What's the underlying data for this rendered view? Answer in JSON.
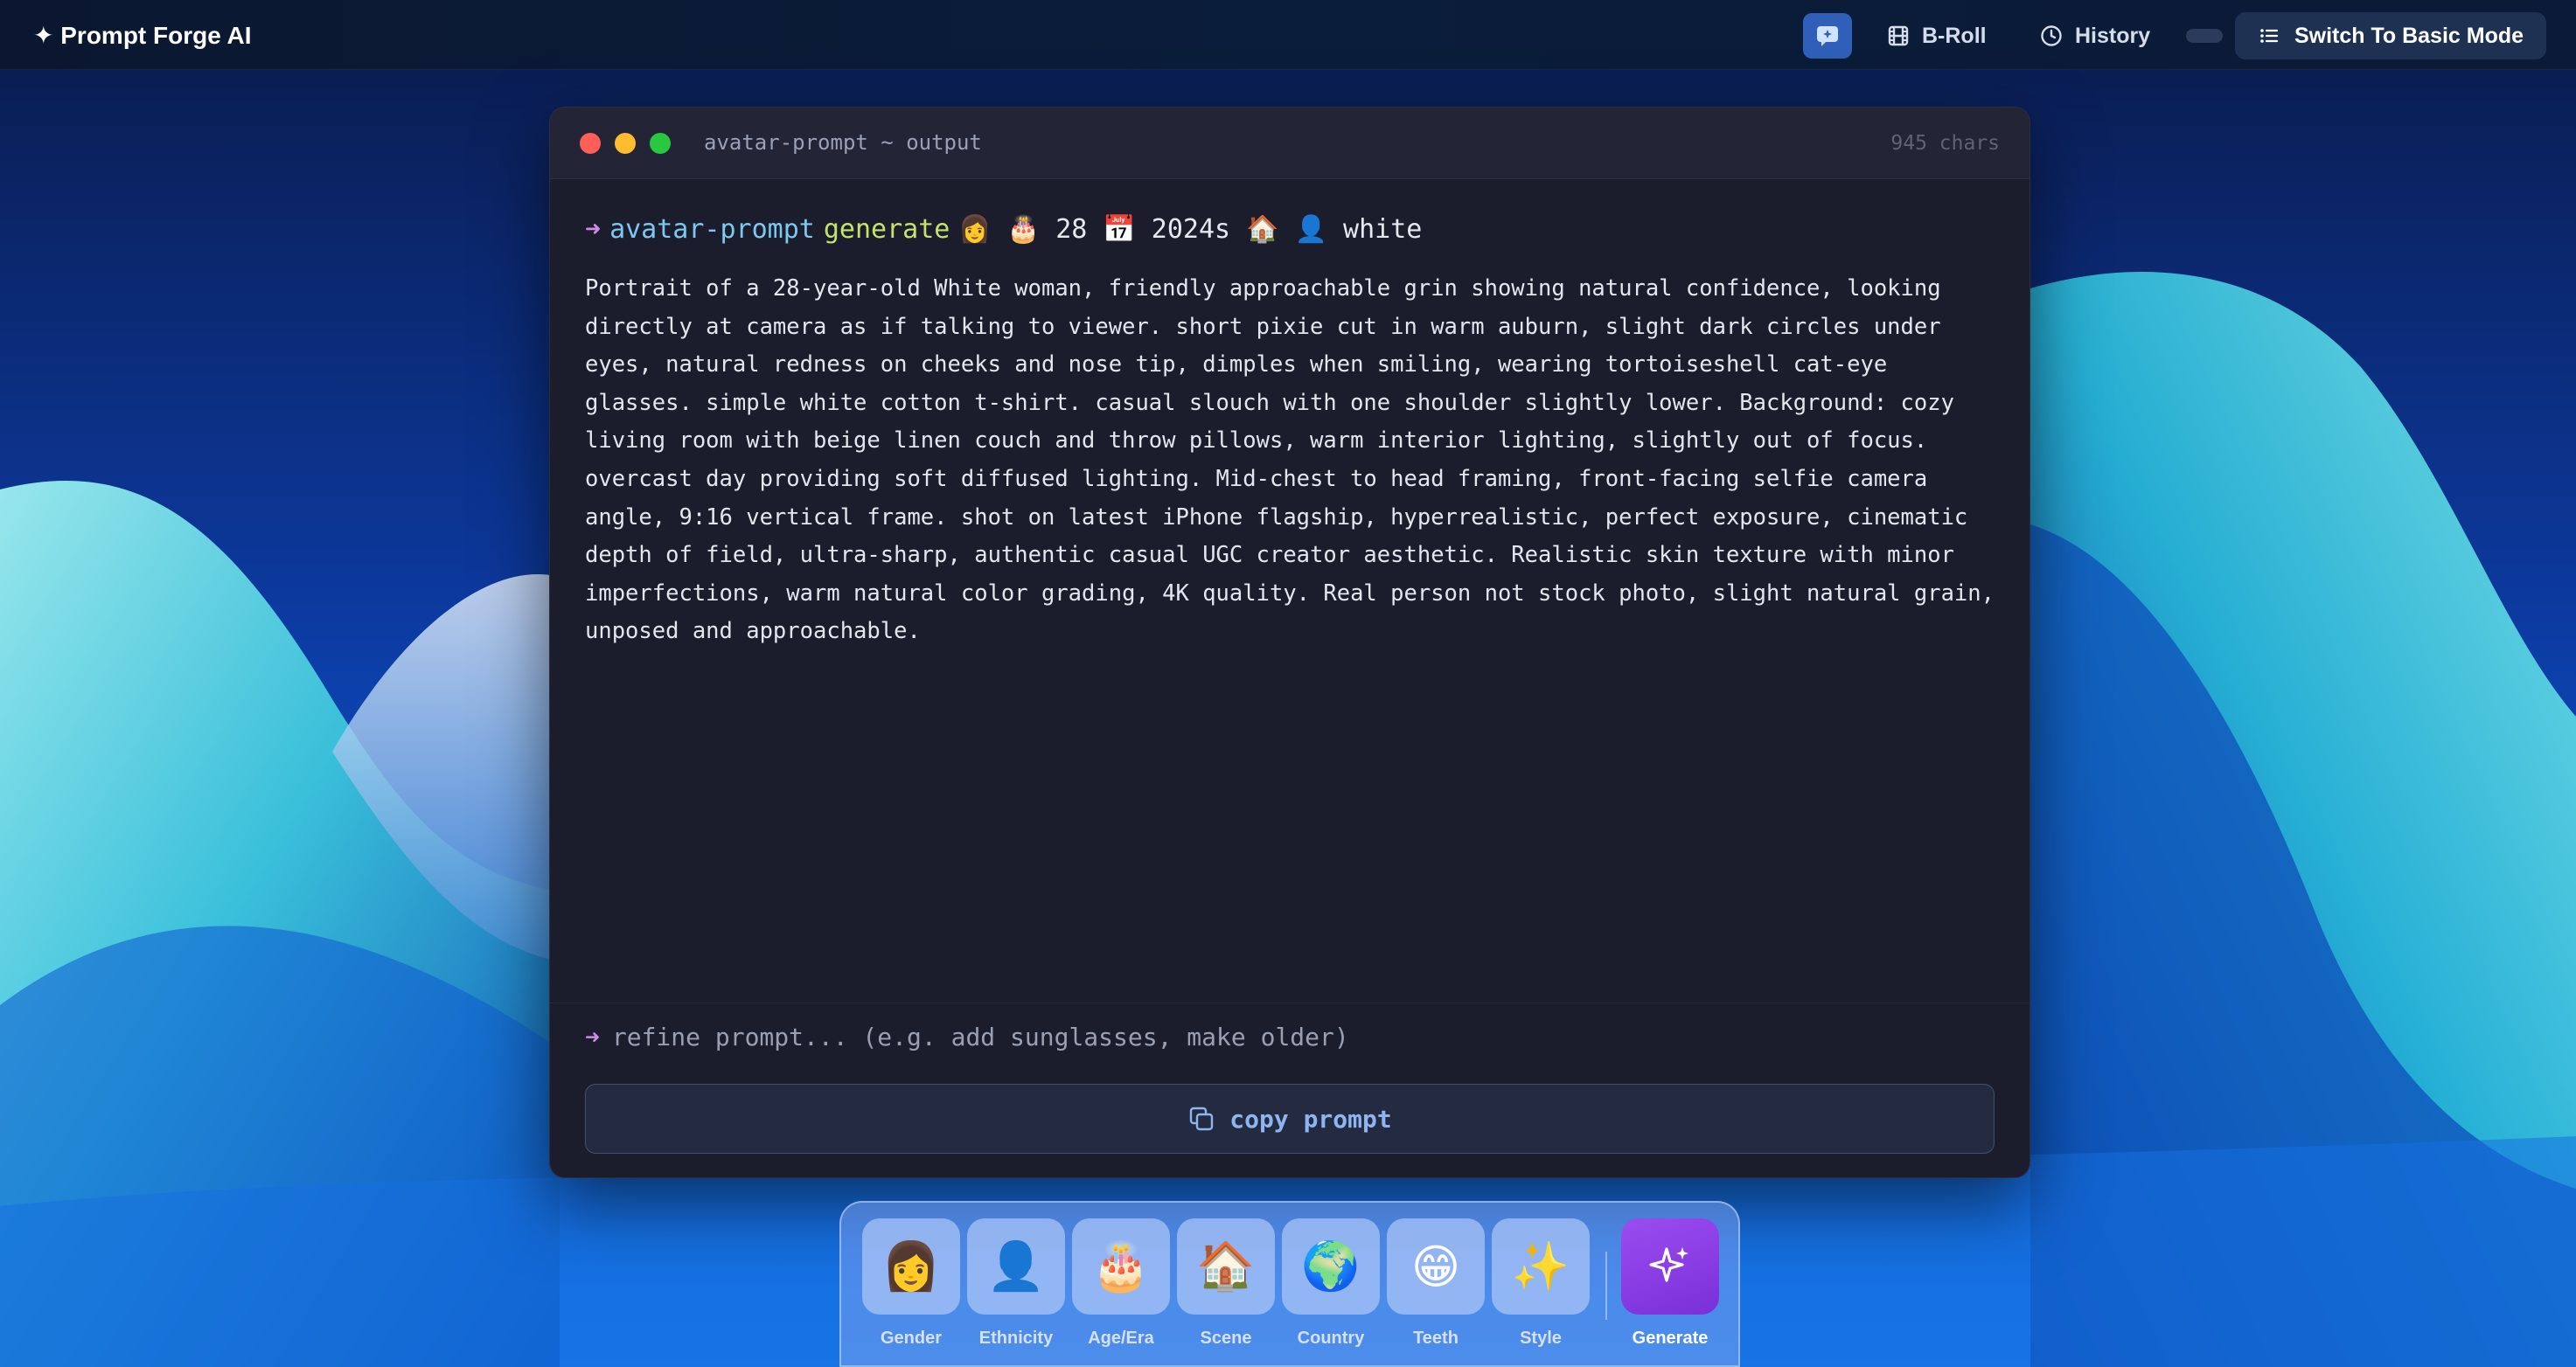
{
  "app": {
    "brand": "✦ Prompt Forge AI",
    "nav": {
      "broll_label": "B-Roll",
      "history_label": "History",
      "basic_mode_label": "Switch To Basic Mode"
    }
  },
  "terminal": {
    "title": "avatar-prompt ~ output",
    "char_count": "945 chars",
    "command": {
      "arrow": "➜",
      "name": "avatar-prompt",
      "verb": "generate",
      "args": "👩 🎂 28 📅 2024s 🏠 👤 white"
    },
    "output": "Portrait of a 28-year-old White woman, friendly approachable grin showing natural confidence, looking directly at camera as if talking to viewer. short pixie cut in warm auburn, slight dark circles under eyes, natural redness on cheeks and nose tip, dimples when smiling, wearing tortoiseshell cat-eye glasses. simple white cotton t-shirt. casual slouch with one shoulder slightly lower. Background: cozy living room with beige linen couch and throw pillows, warm interior lighting, slightly out of focus. overcast day providing soft diffused lighting. Mid-chest to head framing, front-facing selfie camera angle, 9:16 vertical frame. shot on latest iPhone flagship, hyperrealistic, perfect exposure, cinematic depth of field, ultra-sharp, authentic casual UGC creator aesthetic. Realistic skin texture with minor imperfections, warm natural color grading, 4K quality. Real person not stock photo, slight natural grain, unposed and approachable.",
    "refine": {
      "arrow": "➜",
      "placeholder": "refine prompt... (e.g. add sunglasses, make older)",
      "value": ""
    },
    "copy_label": "copy prompt"
  },
  "dock": {
    "items": [
      {
        "emoji": "👩",
        "label": "Gender"
      },
      {
        "emoji": "👤",
        "label": "Ethnicity"
      },
      {
        "emoji": "🎂",
        "label": "Age/Era"
      },
      {
        "emoji": "🏠",
        "label": "Scene"
      },
      {
        "emoji": "🌍",
        "label": "Country"
      },
      {
        "emoji": "😁",
        "label": "Teeth"
      },
      {
        "emoji": "✨",
        "label": "Style"
      }
    ],
    "generate_label": "Generate"
  },
  "colors": {
    "accent": "#7a2fd8",
    "terminal_bg": "#1b1d2c",
    "command_name": "#7cc8f2",
    "command_verb": "#c4e36a",
    "copy_text": "#8fb4f2"
  }
}
